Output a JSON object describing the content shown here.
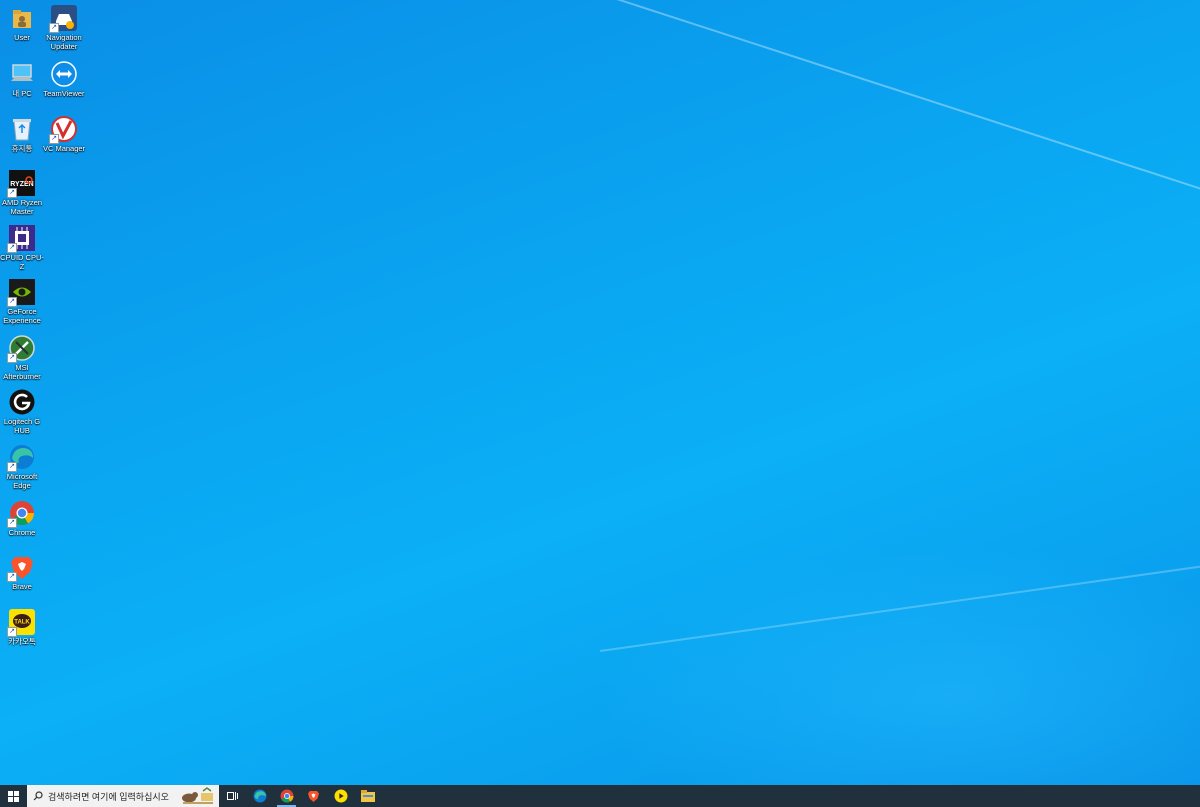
{
  "desktop": {
    "icons": [
      {
        "label": "User",
        "icon": "user-folder-icon"
      },
      {
        "label": "Navigation Updater",
        "icon": "navigation-updater-icon"
      },
      {
        "label": "내 PC",
        "icon": "this-pc-icon"
      },
      {
        "label": "TeamViewer",
        "icon": "teamviewer-icon"
      },
      {
        "label": "휴지통",
        "icon": "recycle-bin-icon"
      },
      {
        "label": "VC Manager",
        "icon": "vc-manager-icon"
      },
      {
        "label": "AMD Ryzen Master",
        "icon": "amd-ryzen-master-icon"
      },
      {
        "label": "CPUID CPU-Z",
        "icon": "cpu-z-icon"
      },
      {
        "label": "GeForce Experience",
        "icon": "geforce-experience-icon"
      },
      {
        "label": "MSI Afterburner",
        "icon": "msi-afterburner-icon"
      },
      {
        "label": "Logitech G HUB",
        "icon": "logitech-g-hub-icon"
      },
      {
        "label": "Microsoft Edge",
        "icon": "edge-icon"
      },
      {
        "label": "Chrome",
        "icon": "chrome-icon"
      },
      {
        "label": "Brave",
        "icon": "brave-icon"
      },
      {
        "label": "카카오톡",
        "icon": "kakaotalk-icon"
      }
    ]
  },
  "taskbar": {
    "search_placeholder": "검색하려면 여기에 입력하십시오",
    "apps": [
      "task-view-icon",
      "edge-icon",
      "chrome-icon",
      "brave-icon",
      "kakaotalk-icon",
      "file-explorer-icon"
    ]
  },
  "colors": {
    "desktop": "#0aa3f0",
    "taskbar": "#20303c",
    "search_box": "#f2f2f2"
  }
}
